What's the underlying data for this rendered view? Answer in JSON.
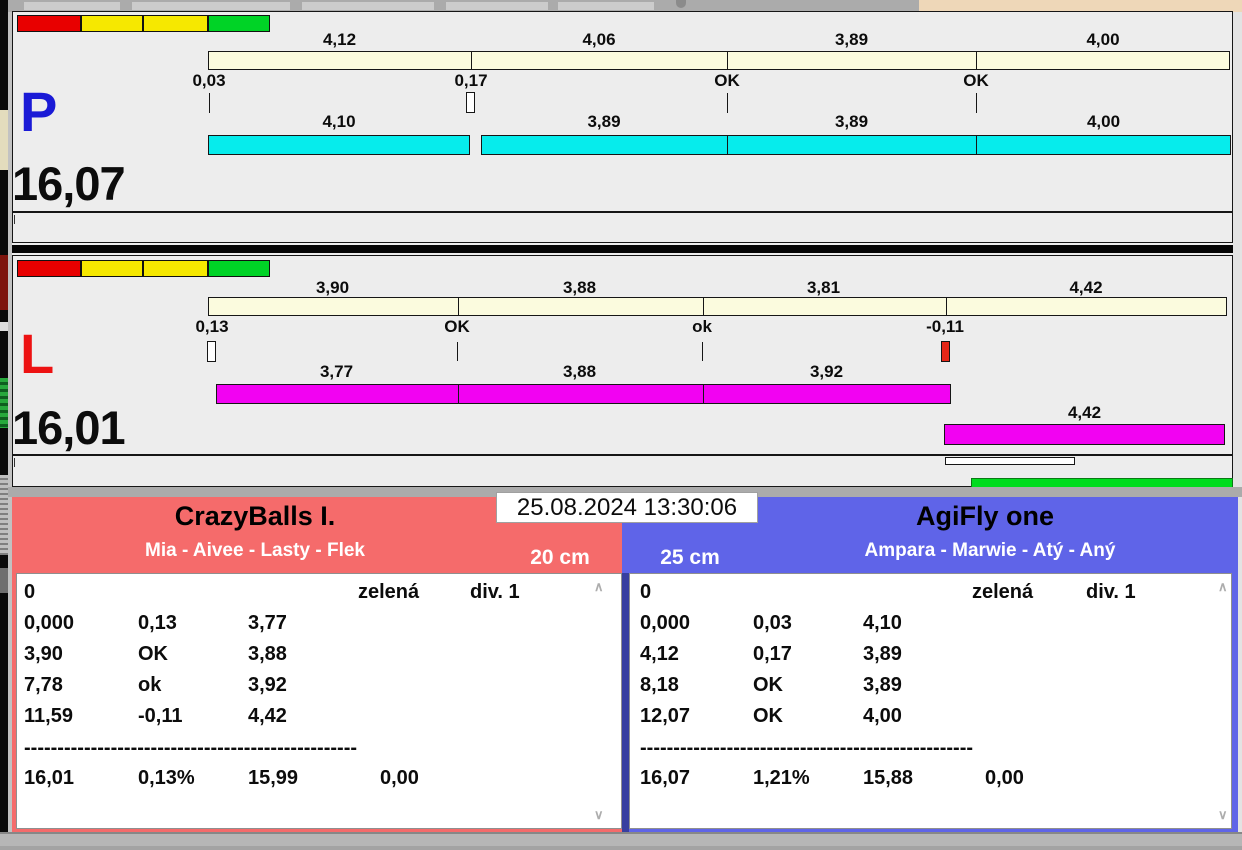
{
  "panel_p": {
    "letter": "P",
    "total": "16,07",
    "split_labels": [
      "4,12",
      "4,06",
      "3,89",
      "4,00"
    ],
    "change_labels": [
      "0,03",
      "0,17",
      "OK",
      "OK"
    ],
    "run_labels": [
      "4,10",
      "3,89",
      "3,89",
      "4,00"
    ]
  },
  "panel_l": {
    "letter": "L",
    "total": "16,01",
    "split_labels": [
      "3,90",
      "3,88",
      "3,81",
      "4,42"
    ],
    "change_labels": [
      "0,13",
      "OK",
      "ok",
      "-0,11"
    ],
    "run_labels": [
      "3,77",
      "3,88",
      "3,92"
    ],
    "extra_run_label": "4,42"
  },
  "datetime": "25.08.2024 13:30:06",
  "team_left": {
    "name": "CrazyBalls I.",
    "dogs": "Mia - Aivee - Lasty - Flek",
    "height": "20 cm",
    "accent": "#F56B6B"
  },
  "team_right": {
    "name": "AgiFly one",
    "dogs": "Ampara - Marwie - Atý - Aný",
    "height": "25 cm",
    "accent": "#5F64E8"
  },
  "results_left": {
    "start": "0",
    "lane_status": "zelená",
    "division": "div. 1",
    "rows": [
      [
        "0,000",
        "0,13",
        "3,77"
      ],
      [
        "3,90",
        "OK",
        "3,88"
      ],
      [
        "7,78",
        "ok",
        "3,92"
      ],
      [
        "11,59",
        "-0,11",
        "4,42"
      ]
    ],
    "separator": "--------------------------------------------------",
    "totals": [
      "16,01",
      "0,13%",
      "15,99",
      "0,00"
    ]
  },
  "results_right": {
    "start": "0",
    "lane_status": "zelená",
    "division": "div. 1",
    "rows": [
      [
        "0,000",
        "0,03",
        "4,10"
      ],
      [
        "4,12",
        "0,17",
        "3,89"
      ],
      [
        "8,18",
        "OK",
        "3,89"
      ],
      [
        "12,07",
        "OK",
        "4,00"
      ]
    ],
    "separator": "--------------------------------------------------",
    "totals": [
      "16,07",
      "1,21%",
      "15,88",
      "0,00"
    ]
  },
  "scroll": {
    "up": "∧",
    "down": "∨"
  },
  "colors": {
    "split_bar": "#FBFBDE",
    "run_bar_p": "#06ECEC",
    "run_bar_l": "#F202F2",
    "light_red": "#E80000",
    "light_yellow": "#F6E800",
    "light_green": "#00D326",
    "marker_fault": "#E52718",
    "team_left_accent": "#F56B6B",
    "team_right_accent": "#5F64E8"
  }
}
